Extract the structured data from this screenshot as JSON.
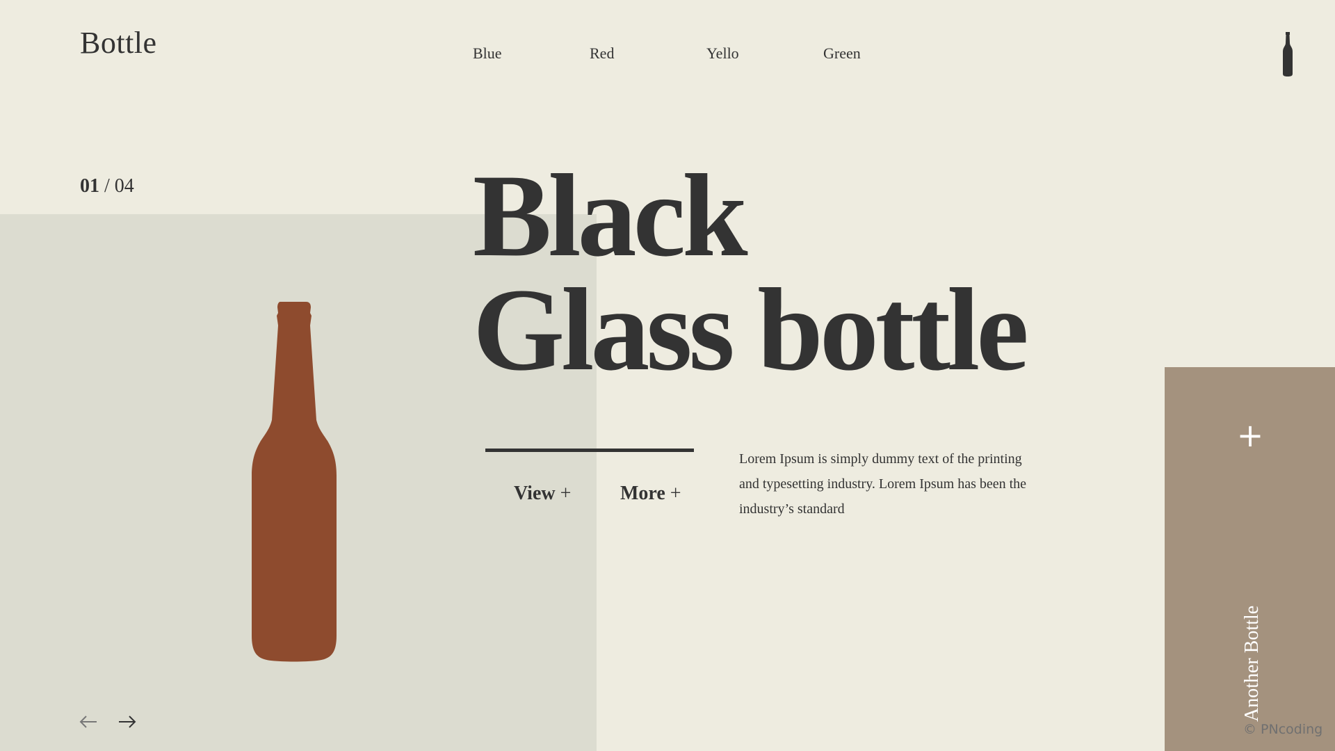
{
  "brand": {
    "logo": "Bottle"
  },
  "nav": {
    "items": [
      {
        "label": "Blue"
      },
      {
        "label": "Red"
      },
      {
        "label": "Yello"
      },
      {
        "label": "Green"
      }
    ]
  },
  "slider": {
    "current": "01",
    "separator": " / ",
    "total": "04"
  },
  "hero": {
    "title_line1": "Black",
    "title_line2": "Glass bottle",
    "bottle_color": "#8e4b2e",
    "view_label": "View",
    "more_label": "More",
    "plus": "+",
    "description": "Lorem Ipsum is simply dummy text of the printing and typesetting industry. Lorem Ipsum has been the industry’s standard"
  },
  "side_panel": {
    "plus": "+",
    "label": "Another Bottle",
    "color": "#a4927e"
  },
  "icons": {
    "corner": "bottle-icon",
    "prev": "arrow-left-icon",
    "next": "arrow-right-icon"
  },
  "credit": "© PNcoding",
  "colors": {
    "background": "#eeece0",
    "left_panel": "#dcdcd0",
    "text": "#333333"
  }
}
